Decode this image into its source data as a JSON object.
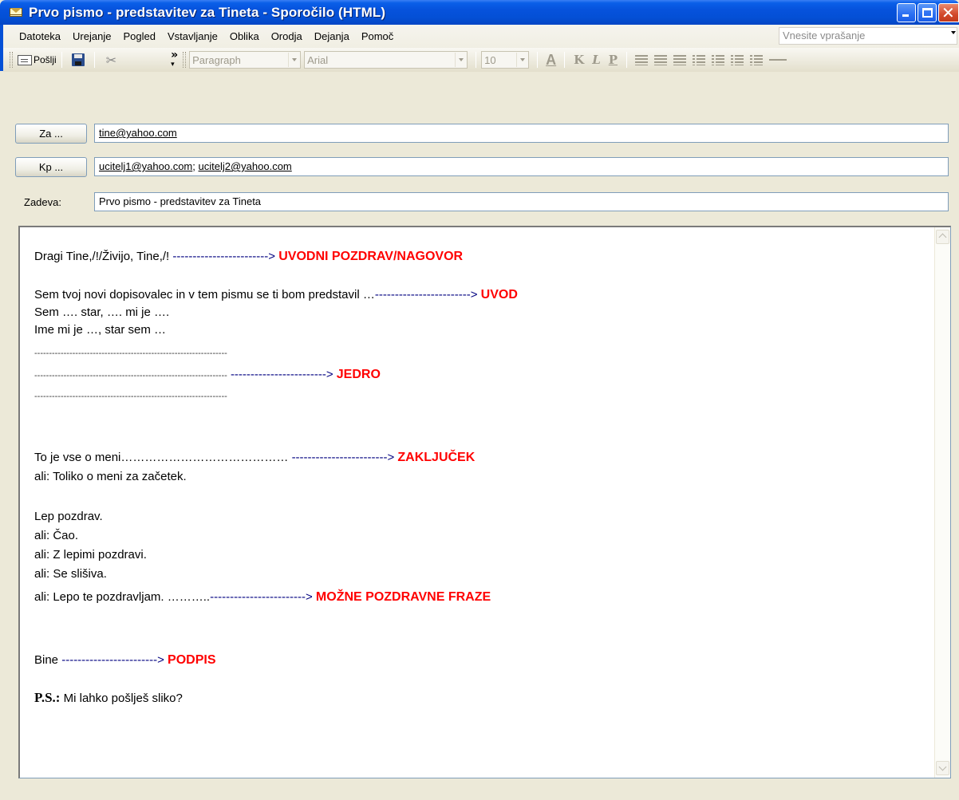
{
  "window": {
    "title": "Prvo pismo - predstavitev za Tineta - Sporočilo (HTML)"
  },
  "menu": {
    "items": [
      "Datoteka",
      "Urejanje",
      "Pogled",
      "Vstavljanje",
      "Oblika",
      "Orodja",
      "Dejanja",
      "Pomoč"
    ],
    "help_placeholder": "Vnesite vprašanje"
  },
  "toolbar": {
    "send_label": "Pošlji",
    "style_value": "Paragraph",
    "font_value": "Arial",
    "size_value": "10"
  },
  "fields": {
    "to_button": "Za ...",
    "to_value": "tine@yahoo.com",
    "cc_button": "Kp ...",
    "cc_value_1": "ucitelj1@yahoo.com",
    "cc_separator": "; ",
    "cc_value_2": "ucitelj2@yahoo.com",
    "subject_label": "Zadeva:",
    "subject_value": "Prvo pismo - predstavitev za Tineta"
  },
  "body": {
    "line1_text": "Dragi Tine,/!/Živijo, Tine,/! ",
    "line1_arrow": "------------------------>",
    "line1_label": "UVODNI POZDRAV/NAGOVOR",
    "line2_text": "Sem tvoj novi dopisovalec in v tem pismu se ti bom predstavil …",
    "line2_arrow": "------------------------>",
    "line2_label": "UVOD",
    "line3_text": "Sem …. star, …. mi je ….",
    "line4_text": "Ime mi je …, star sem …",
    "dots1": "------------------------------------------------------------------",
    "dots2": "------------------------------------------------------------------",
    "dots2_arrow": "------------------------>",
    "dots2_label": "JEDRO",
    "dots3": "------------------------------------------------------------------",
    "line5_text": "To je vse o meni…………………………………… ",
    "line5_arrow": "------------------------>",
    "line5_label": "ZAKLJUČEK",
    "line6_text": "ali: Toliko o meni za začetek.",
    "line7_text": "Lep pozdrav.",
    "line8_text": "ali: Čao.",
    "line9_text": "ali: Z lepimi pozdravi.",
    "line10_text": "ali: Se slišiva.",
    "line11_text": "ali: Lepo te pozdravljam. ………..",
    "line11_arrow": "------------------------>",
    "line11_label": "MOŽNE POZDRAVNE FRAZE",
    "line12_text": "Bine ",
    "line12_arrow": "------------------------>",
    "line12_label": "PODPIS",
    "ps_strong": "P.S.:",
    "ps_text": " Mi lahko pošlješ sliko?"
  },
  "colors": {
    "arrow": "#000080",
    "label": "#ff0000",
    "titlebar": "#0450d6"
  }
}
